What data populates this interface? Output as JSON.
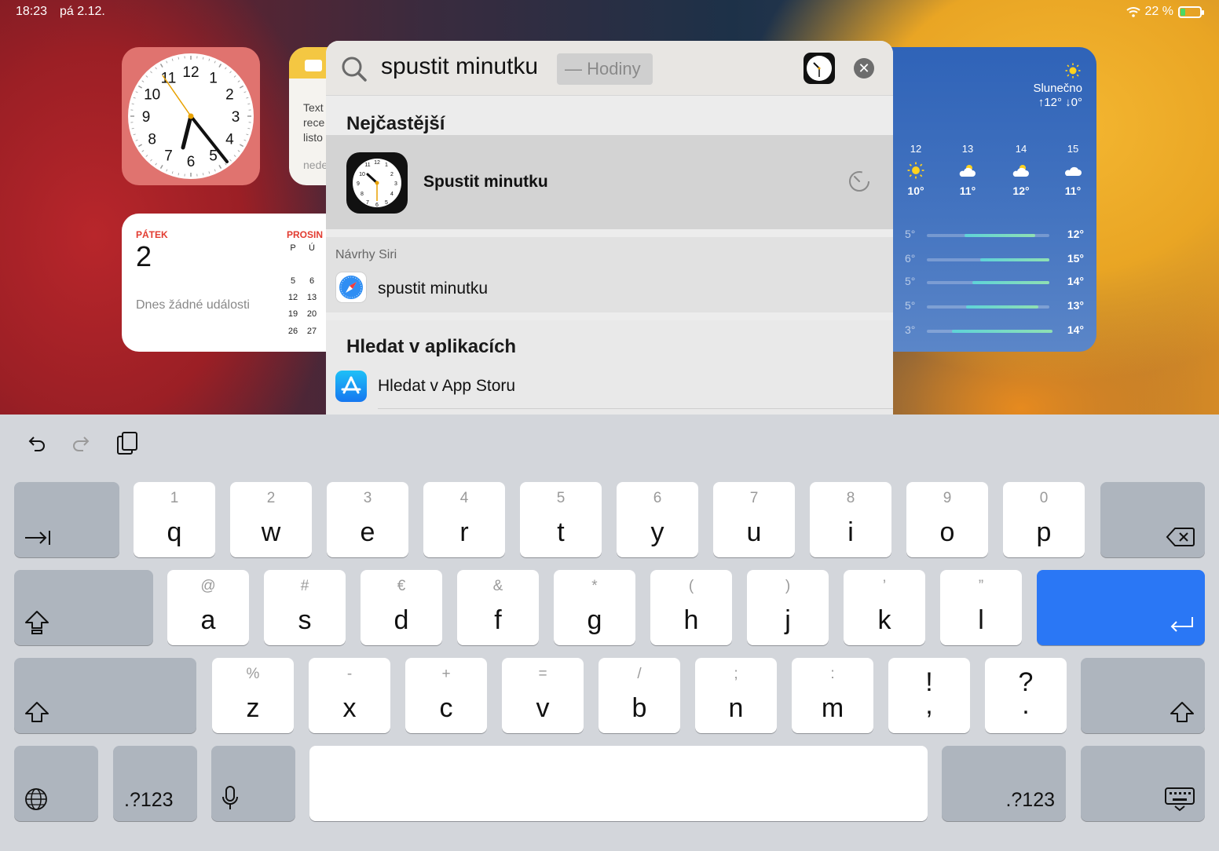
{
  "status_bar": {
    "time": "18:23",
    "date": "pá 2.12.",
    "wifi_icon": "wifi-icon",
    "battery": "22 %"
  },
  "clock_widget": {
    "numbers": [
      "12",
      "1",
      "2",
      "3",
      "4",
      "5",
      "6",
      "7",
      "8",
      "9",
      "10",
      "11"
    ]
  },
  "notes_widget": {
    "lines": [
      "Text",
      "rece",
      "listo"
    ],
    "footer": "nede"
  },
  "calendar_widget": {
    "weekday": "PÁTEK",
    "day": "2",
    "no_events": "Dnes žádné události",
    "month": "PROSIN",
    "mini_header": [
      "P",
      "Ú"
    ],
    "mini_rows": [
      [
        "5",
        "6"
      ],
      [
        "12",
        "13"
      ],
      [
        "19",
        "20"
      ],
      [
        "26",
        "27"
      ]
    ]
  },
  "weather_widget": {
    "condition": "Slunečno",
    "range": "↑12° ↓0°",
    "hours": [
      {
        "h": "12",
        "t": "10°",
        "icon": "sun-icon"
      },
      {
        "h": "13",
        "t": "11°",
        "icon": "partly-cloudy-icon"
      },
      {
        "h": "14",
        "t": "12°",
        "icon": "partly-cloudy-icon"
      },
      {
        "h": "15",
        "t": "11°",
        "icon": "cloud-icon"
      }
    ],
    "days": [
      {
        "lo": "5°",
        "hi": "12°"
      },
      {
        "lo": "6°",
        "hi": "15°"
      },
      {
        "lo": "5°",
        "hi": "14°"
      },
      {
        "lo": "5°",
        "hi": "13°"
      },
      {
        "lo": "3°",
        "hi": "14°"
      }
    ]
  },
  "spotlight": {
    "query": "spustit minutku",
    "completion_hint": "— Hodiny",
    "top_section": "Nejčastější",
    "top_hit_label": "Spustit minutku",
    "siri_section": "Návrhy Siri",
    "siri_item": "spustit minutku",
    "apps_section": "Hledat v aplikacích",
    "apps_item": "Hledat v App Storu"
  },
  "keyboard": {
    "row1": [
      {
        "k": "q",
        "a": "1"
      },
      {
        "k": "w",
        "a": "2"
      },
      {
        "k": "e",
        "a": "3"
      },
      {
        "k": "r",
        "a": "4"
      },
      {
        "k": "t",
        "a": "5"
      },
      {
        "k": "y",
        "a": "6"
      },
      {
        "k": "u",
        "a": "7"
      },
      {
        "k": "i",
        "a": "8"
      },
      {
        "k": "o",
        "a": "9"
      },
      {
        "k": "p",
        "a": "0"
      }
    ],
    "row2": [
      {
        "k": "a",
        "a": "@"
      },
      {
        "k": "s",
        "a": "#"
      },
      {
        "k": "d",
        "a": "€"
      },
      {
        "k": "f",
        "a": "&"
      },
      {
        "k": "g",
        "a": "*"
      },
      {
        "k": "h",
        "a": "("
      },
      {
        "k": "j",
        "a": ")"
      },
      {
        "k": "k",
        "a": "’"
      },
      {
        "k": "l",
        "a": "”"
      }
    ],
    "row3": [
      {
        "k": "z",
        "a": "%"
      },
      {
        "k": "x",
        "a": "-"
      },
      {
        "k": "c",
        "a": "+"
      },
      {
        "k": "v",
        "a": "="
      },
      {
        "k": "b",
        "a": "/"
      },
      {
        "k": "n",
        "a": ";"
      },
      {
        "k": "m",
        "a": ":"
      },
      {
        "k": ",",
        "a": "!"
      },
      {
        "k": ".",
        "a": "?"
      }
    ],
    "num_left": ".?123",
    "num_right": ".?123"
  }
}
